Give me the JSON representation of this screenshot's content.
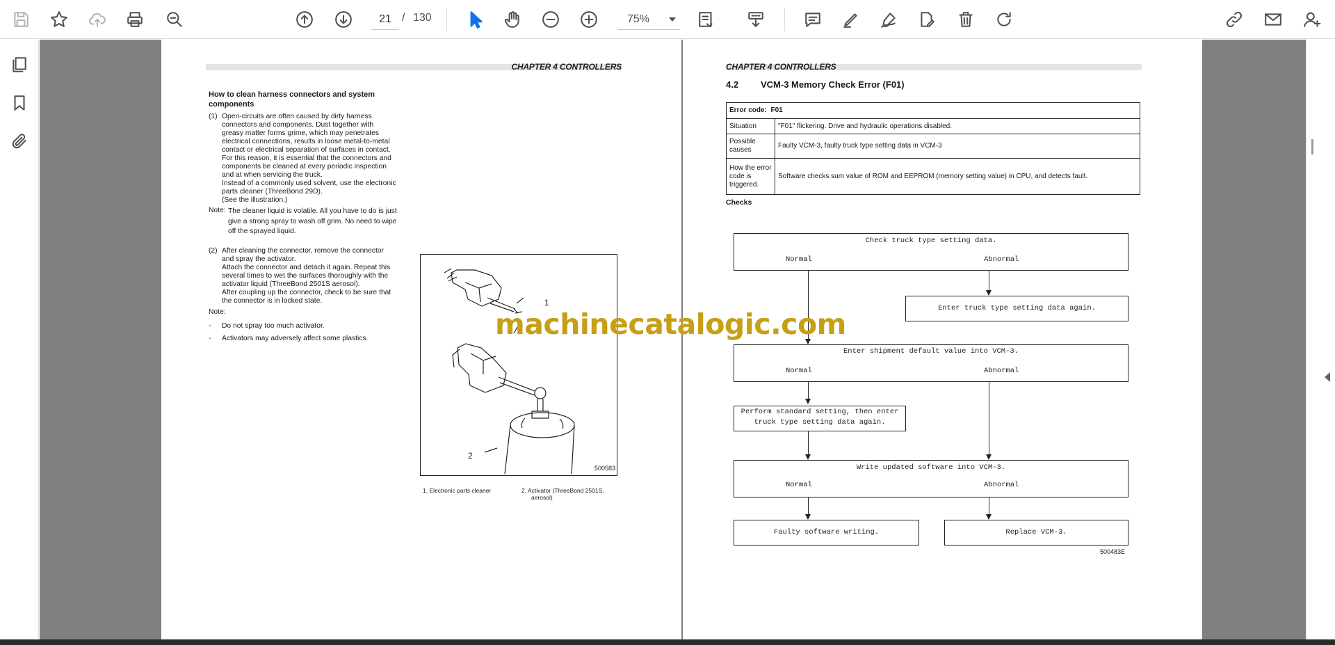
{
  "toolbar": {
    "page_current": "21",
    "page_separator": "/",
    "page_total": "130",
    "zoom": "75%",
    "accent_color": "#1473e6",
    "icons_left": [
      "save-icon",
      "bookmark-star-icon",
      "cloud-upload-icon",
      "print-icon",
      "zoom-search-icon"
    ],
    "icons_nav": [
      "previous-page-icon",
      "next-page-icon"
    ],
    "icons_tools": [
      "select-cursor-icon",
      "hand-pan-icon",
      "zoom-out-icon",
      "zoom-in-icon",
      "page-fit-icon",
      "scroll-mode-icon",
      "comment-icon",
      "pen-highlight-icon",
      "sign-icon",
      "fill-sign-icon",
      "delete-icon",
      "rotate-icon",
      "share-link-icon",
      "email-icon",
      "add-user-icon"
    ]
  },
  "left_rail": {
    "icons": [
      "page-thumbnails-icon",
      "bookmarks-icon",
      "attachments-icon"
    ]
  },
  "watermark": "machinecatalogic.com",
  "left_page": {
    "chapter": "CHAPTER 4  CONTROLLERS",
    "heading": "How to clean harness connectors and system components",
    "para1_num": "(1)",
    "para1_lines": [
      "Open-circuits are often caused by dirty harness",
      "connectors and components. Dust together with",
      "greasy matter forms grime, which may penetrates",
      "electrical connections, results in loose metal-to-metal",
      "contact or electrical separation of surfaces in contact.",
      "For this reason, it is essential that the connectors and",
      "components be cleaned at every periodic inspection",
      "and at when servicing the truck.",
      "Instead of a commonly used solvent, use the electronic",
      "parts cleaner (ThreeBond 29D).",
      "(See the illustration.)"
    ],
    "note1_label": "Note:",
    "note1_lines": [
      "The cleaner liquid is volatile. All you have to do is just",
      "give a strong spray to wash off grim. No need to wipe",
      "off the sprayed liquid."
    ],
    "para2_num": "(2)",
    "para2_lines": [
      "After cleaning the connector, remove the connector",
      "and spray the activator.",
      "Attach the connector and detach it again. Repeat this",
      "several times to wet the surfaces thoroughly with the",
      "activator liquid (ThreeBond 2501S aerosol).",
      "After coupling up the connector, check to be sure that",
      "the connector is in locked state."
    ],
    "note2_label": "Note:",
    "bullets": [
      "Do not spray too much activator.",
      "Activators may adversely affect some plastics."
    ],
    "bullet_mark": "-",
    "figure": {
      "code": "500583",
      "callout1": "1",
      "callout2": "2",
      "caption1": "1.  Electronic parts cleaner",
      "caption2_line1": "2.  Activator (ThreeBond 2501S,",
      "caption2_line2": "aerosol)"
    }
  },
  "right_page": {
    "chapter": "CHAPTER 4  CONTROLLERS",
    "section_num": "4.2",
    "section_title": "VCM-3 Memory Check Error (F01)",
    "error_code_label": "Error code:",
    "error_code": "F01",
    "table_rows": [
      {
        "label": "Situation",
        "value": "\"F01\" flickering. Drive and hydraulic operations disabled."
      },
      {
        "label": "Possible causes",
        "value": "Faulty VCM-3, faulty truck type setting data in VCM-3"
      },
      {
        "label": "How the error code is triggered.",
        "value": "Software checks sum value of ROM and EEPROM (memory setting value) in CPU, and detects fault."
      }
    ],
    "checks_label": "Checks",
    "flowchart": {
      "box1": "Check truck type setting data.",
      "box2": "Enter truck type setting data again.",
      "box3": "Enter shipment default value into VCM-3.",
      "box4_line1": "Perform standard setting, then enter",
      "box4_line2": "truck type setting data again.",
      "box5": "Write updated software into VCM-3.",
      "box6": "Faulty software writing.",
      "box7": "Replace VCM-3.",
      "normal": "Normal",
      "abnormal": "Abnormal",
      "code": "500483E"
    }
  }
}
